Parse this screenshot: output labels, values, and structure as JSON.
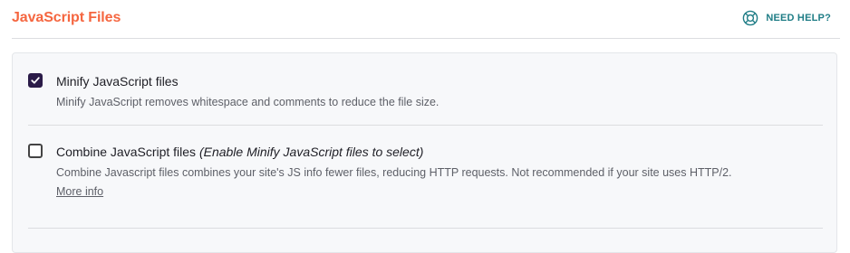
{
  "header": {
    "title": "JavaScript Files",
    "help_label": "NEED HELP?",
    "help_icon": "lifebuoy-icon"
  },
  "colors": {
    "title_accent": "#f56640",
    "help_link": "#1f7d86",
    "checkbox_checked": "#2b1b48",
    "panel_background": "#f7f8fa"
  },
  "options": [
    {
      "label": "Minify JavaScript files",
      "note": "",
      "checked": true,
      "description": "Minify JavaScript removes whitespace and comments to reduce the file size.",
      "link": ""
    },
    {
      "label": "Combine JavaScript files",
      "note": "(Enable Minify JavaScript files to select)",
      "checked": false,
      "description": "Combine Javascript files combines your site's JS info fewer files, reducing HTTP requests. Not recommended if your site uses HTTP/2.",
      "link": "More info"
    }
  ]
}
